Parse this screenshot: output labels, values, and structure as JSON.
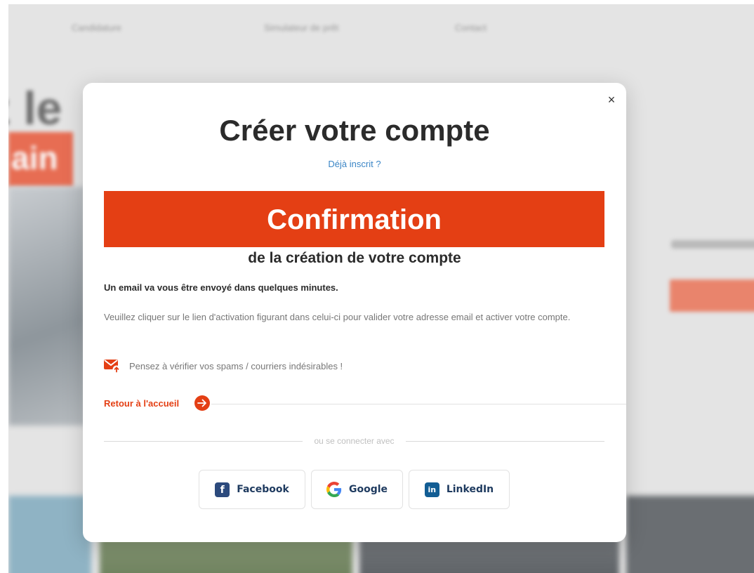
{
  "background": {
    "nav_items": [
      "Candidature",
      "Simulateur de prêt",
      "Contact"
    ],
    "hero_text": "z le",
    "hero_tag": "ain"
  },
  "modal": {
    "close_label": "×",
    "title": "Créer votre compte",
    "login_link": "Déjà inscrit ?",
    "banner_text": "Confirmation",
    "subtitle": "de la création de votre compte",
    "lead": "Un email va vous être envoyé dans quelques minutes.",
    "description": "Veuillez cliquer sur le lien d'activation figurant dans celui-ci pour valider votre adresse email et activer votre compte.",
    "spam_notice": "Pensez à vérifier vos spams / courriers indésirables !",
    "home_link": "Retour à l'accueil",
    "divider_text": "ou se connecter avec",
    "social": {
      "facebook": {
        "label": "Facebook",
        "icon": "facebook-icon",
        "glyph": "f"
      },
      "google": {
        "label": "Google",
        "icon": "google-icon"
      },
      "linkedin": {
        "label": "LinkedIn",
        "icon": "linkedin-icon",
        "glyph": "in"
      }
    }
  },
  "colors": {
    "accent": "#e43f14",
    "link": "#3b86c6",
    "facebook": "#2c4a7d",
    "linkedin": "#125d94"
  }
}
